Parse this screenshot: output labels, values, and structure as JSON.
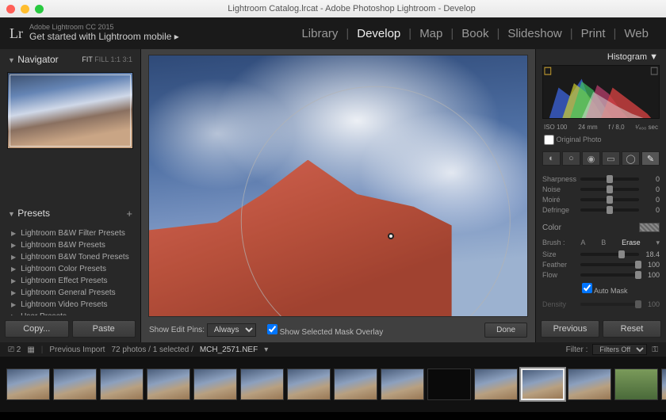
{
  "titlebar": {
    "title": "Lightroom Catalog.lrcat - Adobe Photoshop Lightroom - Develop"
  },
  "identity": {
    "product": "Adobe Lightroom CC 2015",
    "tagline": "Get started with Lightroom mobile  ▸"
  },
  "modules": {
    "items": [
      "Library",
      "Develop",
      "Map",
      "Book",
      "Slideshow",
      "Print",
      "Web"
    ],
    "active": "Develop"
  },
  "navigator": {
    "title": "Navigator",
    "zoom": {
      "fit": "FIT",
      "fill": "FILL",
      "one": "1:1",
      "three": "3:1"
    }
  },
  "presets": {
    "title": "Presets",
    "items": [
      "Lightroom B&W Filter Presets",
      "Lightroom B&W Presets",
      "Lightroom B&W Toned Presets",
      "Lightroom Color Presets",
      "Lightroom Effect Presets",
      "Lightroom General Presets",
      "Lightroom Video Presets",
      "User Presets"
    ]
  },
  "left_buttons": {
    "copy": "Copy...",
    "paste": "Paste"
  },
  "center_toolbar": {
    "pins_label": "Show Edit Pins:",
    "pins_value": "Always",
    "mask_overlay": "Show Selected Mask Overlay",
    "done": "Done"
  },
  "histogram": {
    "title": "Histogram",
    "meta": {
      "iso": "ISO 100",
      "focal": "24 mm",
      "aperture": "f / 8,0",
      "shutter": "¹⁄₄₀₀ sec"
    },
    "original": "Original Photo"
  },
  "tools": [
    "◐",
    "○",
    "◉",
    "▭",
    "◯",
    "✎"
  ],
  "detail": {
    "sharpness": {
      "label": "Sharpness",
      "value": "0",
      "pos": 50
    },
    "noise": {
      "label": "Noise",
      "value": "0",
      "pos": 50
    },
    "moire": {
      "label": "Moiré",
      "value": "0",
      "pos": 50
    },
    "defringe": {
      "label": "Defringe",
      "value": "0",
      "pos": 50
    },
    "color": "Color"
  },
  "brush": {
    "header": "Brush :",
    "tabs": {
      "a": "A",
      "b": "B",
      "erase": "Erase"
    },
    "size": {
      "label": "Size",
      "value": "18.4",
      "pos": 70
    },
    "feather": {
      "label": "Feather",
      "value": "100",
      "pos": 100
    },
    "flow": {
      "label": "Flow",
      "value": "100",
      "pos": 100
    },
    "automask": "Auto Mask",
    "density": {
      "label": "Density",
      "value": "100",
      "pos": 100
    }
  },
  "right_buttons": {
    "previous": "Previous",
    "reset": "Reset"
  },
  "filmbar": {
    "nav": "Previous Import",
    "count": "72 photos / 1 selected /",
    "filename": "MCH_2571.NEF",
    "filter_label": "Filter :",
    "filter_value": "Filters Off"
  }
}
